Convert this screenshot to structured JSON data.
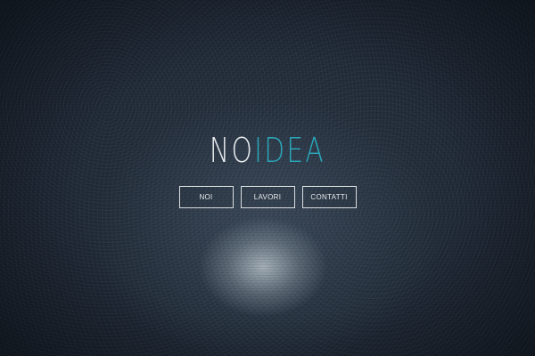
{
  "logo": {
    "part_a": "NO",
    "part_b": "IDEA",
    "accent_color": "#2aa6b8"
  },
  "nav": {
    "items": [
      {
        "label": "NOI"
      },
      {
        "label": "LAVORI"
      },
      {
        "label": "CONTATTI"
      }
    ]
  }
}
